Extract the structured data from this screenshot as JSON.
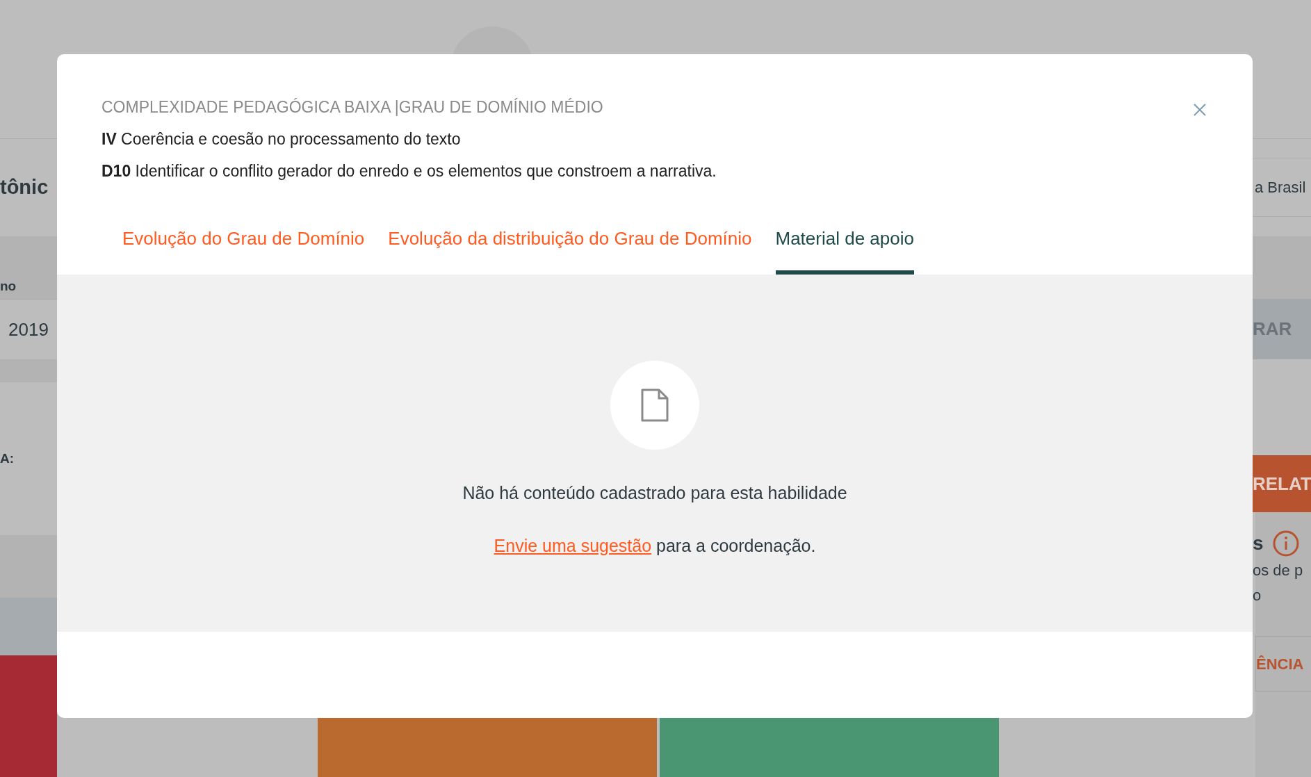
{
  "background": {
    "heading_fragment": "tônic",
    "column_label_fragment": "no",
    "year_fragment": "2019",
    "field_label_fragment": "A:",
    "location_fragment": "a Brasil",
    "filter_button_fragment": "RAR",
    "report_button_fragment": "RELAT",
    "section_title_fragment": "s",
    "description_fragments": [
      "os de p",
      "o"
    ],
    "link_fragment": "ÊNCIA"
  },
  "modal": {
    "category": "COMPLEXIDADE PEDAGÓGICA BAIXA |GRAU DE DOMÍNIO MÉDIO",
    "lines": [
      "**IV** Coerência e coesão no processamento do texto",
      "**D10** Identificar o conflito gerador do enredo e os elementos que constroem a narrativa."
    ],
    "tabs": [
      {
        "label": "Evolução do Grau de Domínio",
        "selected": false
      },
      {
        "label": "Evolução da distribuição do Grau de Domínio",
        "selected": false
      },
      {
        "label": "Material de apoio",
        "selected": true
      }
    ],
    "empty_state": {
      "message": "Não há conteúdo cadastrado para esta habilidade",
      "link": "Envie uma sugestão",
      "after_link": "para a coordenação."
    }
  }
}
